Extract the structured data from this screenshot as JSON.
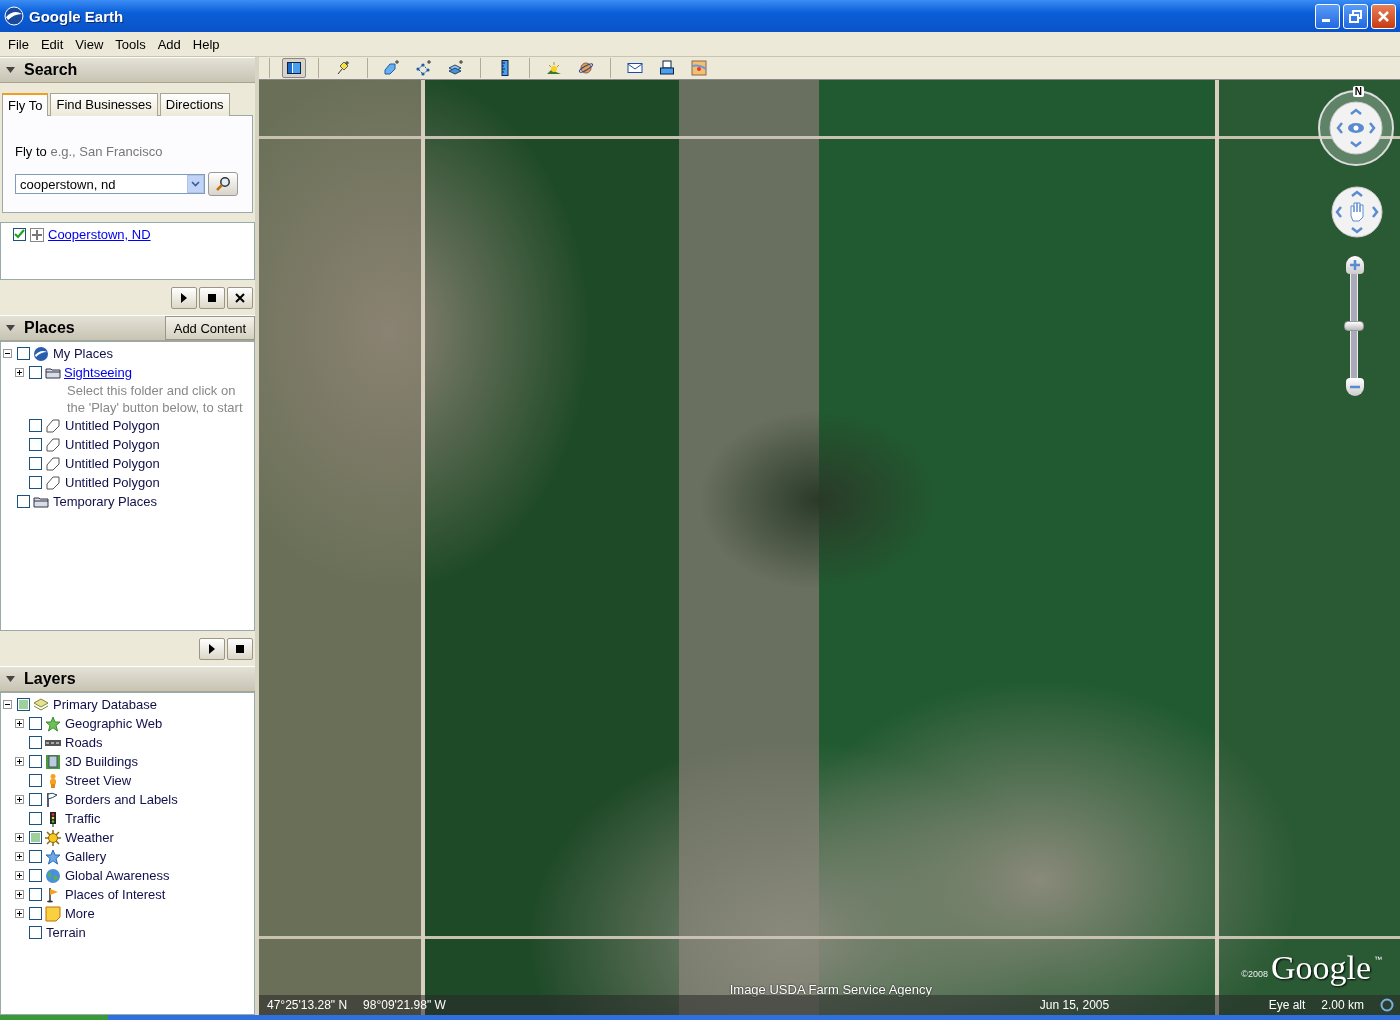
{
  "window": {
    "title": "Google Earth"
  },
  "menu": [
    {
      "label": "File"
    },
    {
      "label": "Edit"
    },
    {
      "label": "View"
    },
    {
      "label": "Tools"
    },
    {
      "label": "Add"
    },
    {
      "label": "Help"
    }
  ],
  "search": {
    "title": "Search",
    "expanded": true,
    "tabs": [
      {
        "label": "Fly To",
        "selected": true
      },
      {
        "label": "Find Businesses",
        "selected": false
      },
      {
        "label": "Directions",
        "selected": false
      }
    ],
    "prompt": "Fly to",
    "hint": "e.g., San Francisco",
    "query": "cooperstown, nd",
    "results": [
      {
        "label": "Cooperstown, ND",
        "checked": true,
        "kind": "placemark"
      }
    ]
  },
  "places": {
    "title": "Places",
    "expanded": true,
    "add_content": "Add Content",
    "tree": [
      {
        "label": "My Places",
        "kind": "globe",
        "checked": false,
        "partial": false,
        "expanded": true,
        "children": [
          {
            "label": "Sightseeing",
            "kind": "tour-folder",
            "checked": false,
            "partial": false,
            "expanded": false,
            "description": "Select this folder and click on the 'Play' button below, to start"
          },
          {
            "label": "Untitled Polygon",
            "kind": "polygon",
            "checked": false,
            "partial": false
          },
          {
            "label": "Untitled Polygon",
            "kind": "polygon",
            "checked": false,
            "partial": false
          },
          {
            "label": "Untitled Polygon",
            "kind": "polygon",
            "checked": false,
            "partial": false
          },
          {
            "label": "Untitled Polygon",
            "kind": "polygon",
            "checked": false,
            "partial": false
          }
        ]
      },
      {
        "label": "Temporary Places",
        "kind": "folder",
        "checked": false,
        "partial": false
      }
    ]
  },
  "layers": {
    "title": "Layers",
    "expanded": true,
    "tree": [
      {
        "label": "Primary Database",
        "kind": "layers",
        "checked": false,
        "partial": true,
        "expanded": true,
        "children": [
          {
            "label": "Geographic Web",
            "kind": "green-star",
            "checked": false,
            "partial": false,
            "expanded": false
          },
          {
            "label": "Roads",
            "kind": "road",
            "checked": false,
            "partial": false
          },
          {
            "label": "3D Buildings",
            "kind": "building",
            "checked": false,
            "partial": false,
            "expanded": false
          },
          {
            "label": "Street View",
            "kind": "person",
            "checked": false,
            "partial": false
          },
          {
            "label": "Borders and Labels",
            "kind": "flag",
            "checked": false,
            "partial": false,
            "expanded": false
          },
          {
            "label": "Traffic",
            "kind": "traffic",
            "checked": false,
            "partial": false
          },
          {
            "label": "Weather",
            "kind": "sun",
            "checked": false,
            "partial": true,
            "expanded": false
          },
          {
            "label": "Gallery",
            "kind": "blue-star",
            "checked": false,
            "partial": false,
            "expanded": false
          },
          {
            "label": "Global Awareness",
            "kind": "earth",
            "checked": false,
            "partial": false,
            "expanded": false
          },
          {
            "label": "Places of Interest",
            "kind": "pennant",
            "checked": false,
            "partial": false,
            "expanded": false
          },
          {
            "label": "More",
            "kind": "note",
            "checked": false,
            "partial": false,
            "expanded": false
          },
          {
            "label": "Terrain",
            "kind": "none",
            "checked": false,
            "partial": false
          }
        ]
      }
    ]
  },
  "toolbar": [
    {
      "buttons": [
        {
          "kind": "sidebar",
          "pressed": true
        }
      ]
    },
    {
      "buttons": [
        {
          "kind": "pushpin",
          "pressed": false
        }
      ]
    },
    {
      "buttons": [
        {
          "kind": "polygon-add",
          "pressed": false
        },
        {
          "kind": "path",
          "pressed": false
        },
        {
          "kind": "overlay",
          "pressed": false
        }
      ]
    },
    {
      "buttons": [
        {
          "kind": "ruler",
          "pressed": false
        }
      ]
    },
    {
      "buttons": [
        {
          "kind": "sunrise",
          "pressed": false
        },
        {
          "kind": "planet",
          "pressed": false
        }
      ]
    },
    {
      "buttons": [
        {
          "kind": "envelope",
          "pressed": false
        },
        {
          "kind": "printer",
          "pressed": false
        },
        {
          "kind": "map",
          "pressed": false
        }
      ]
    }
  ],
  "map": {
    "north": "N",
    "zoom": {
      "level": 0.5
    },
    "attribution": "Image USDA Farm Service Agency",
    "copyright": "©2008",
    "logo": "Google",
    "trademark": "™",
    "status_bar": {
      "latitude": "47°25'13.28\" N",
      "longitude": "98°09'21.98\" W",
      "date": "Jun 15, 2005",
      "eye_alt_label": "Eye alt",
      "eye_alt": "2.00 km"
    }
  }
}
